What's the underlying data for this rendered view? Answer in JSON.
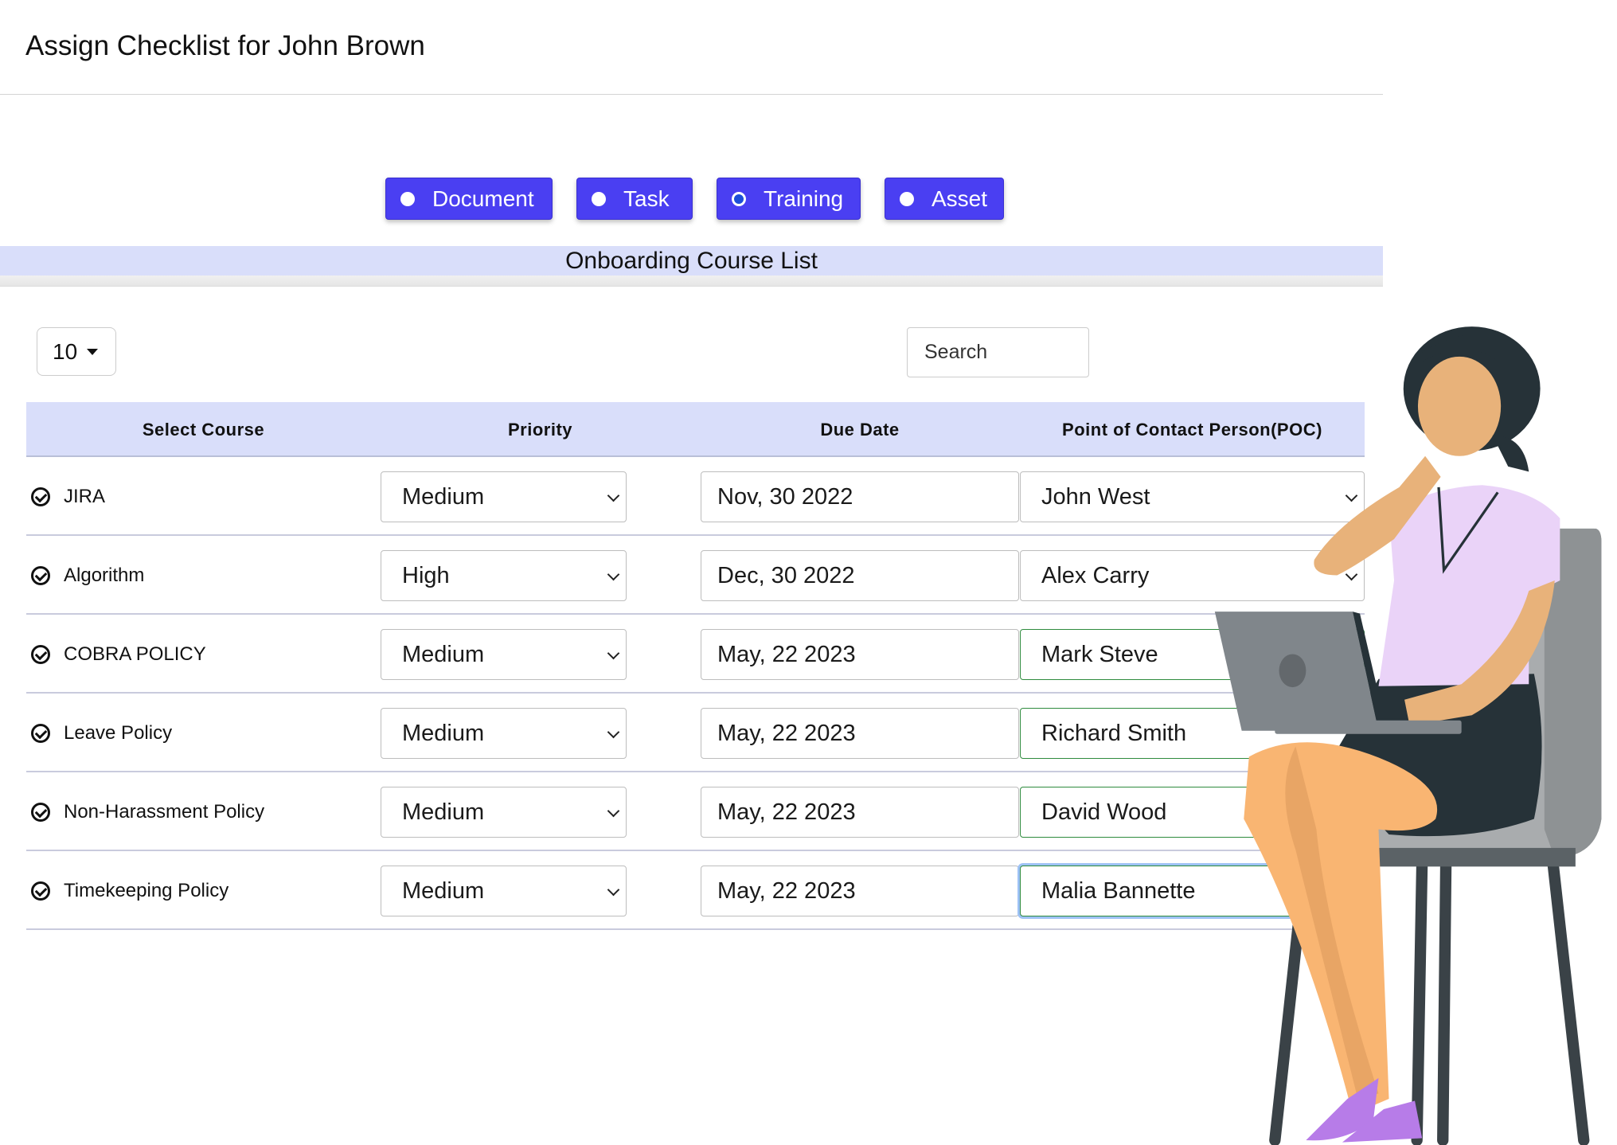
{
  "header": {
    "title": "Assign Checklist for John Brown"
  },
  "types": [
    {
      "label": "Document",
      "selected": false
    },
    {
      "label": "Task",
      "selected": false
    },
    {
      "label": "Training",
      "selected": true
    },
    {
      "label": "Asset",
      "selected": false
    }
  ],
  "section_title": "Onboarding Course List",
  "controls": {
    "page_size": "10",
    "search_placeholder": "Search"
  },
  "table": {
    "columns": [
      "Select Course",
      "Priority",
      "Due Date",
      "Point of Contact Person(POC)"
    ],
    "rows": [
      {
        "course": "JIRA",
        "priority": "Medium",
        "due": "Nov, 30 2022",
        "poc": "John West"
      },
      {
        "course": "Algorithm",
        "priority": "High",
        "due": "Dec, 30 2022",
        "poc": "Alex Carry"
      },
      {
        "course": "COBRA POLICY",
        "priority": "Medium",
        "due": "May, 22 2023",
        "poc": "Mark Steve"
      },
      {
        "course": "Leave Policy",
        "priority": "Medium",
        "due": "May, 22 2023",
        "poc": "Richard Smith"
      },
      {
        "course": "Non-Harassment Policy",
        "priority": "Medium",
        "due": "May, 22 2023",
        "poc": "David Wood"
      },
      {
        "course": "Timekeeping Policy",
        "priority": "Medium",
        "due": "May, 22 2023",
        "poc": "Malia Bannette"
      }
    ]
  },
  "colors": {
    "accent": "#4a3ff2",
    "band": "#d9defa",
    "valid_border": "#2e8b3d"
  }
}
